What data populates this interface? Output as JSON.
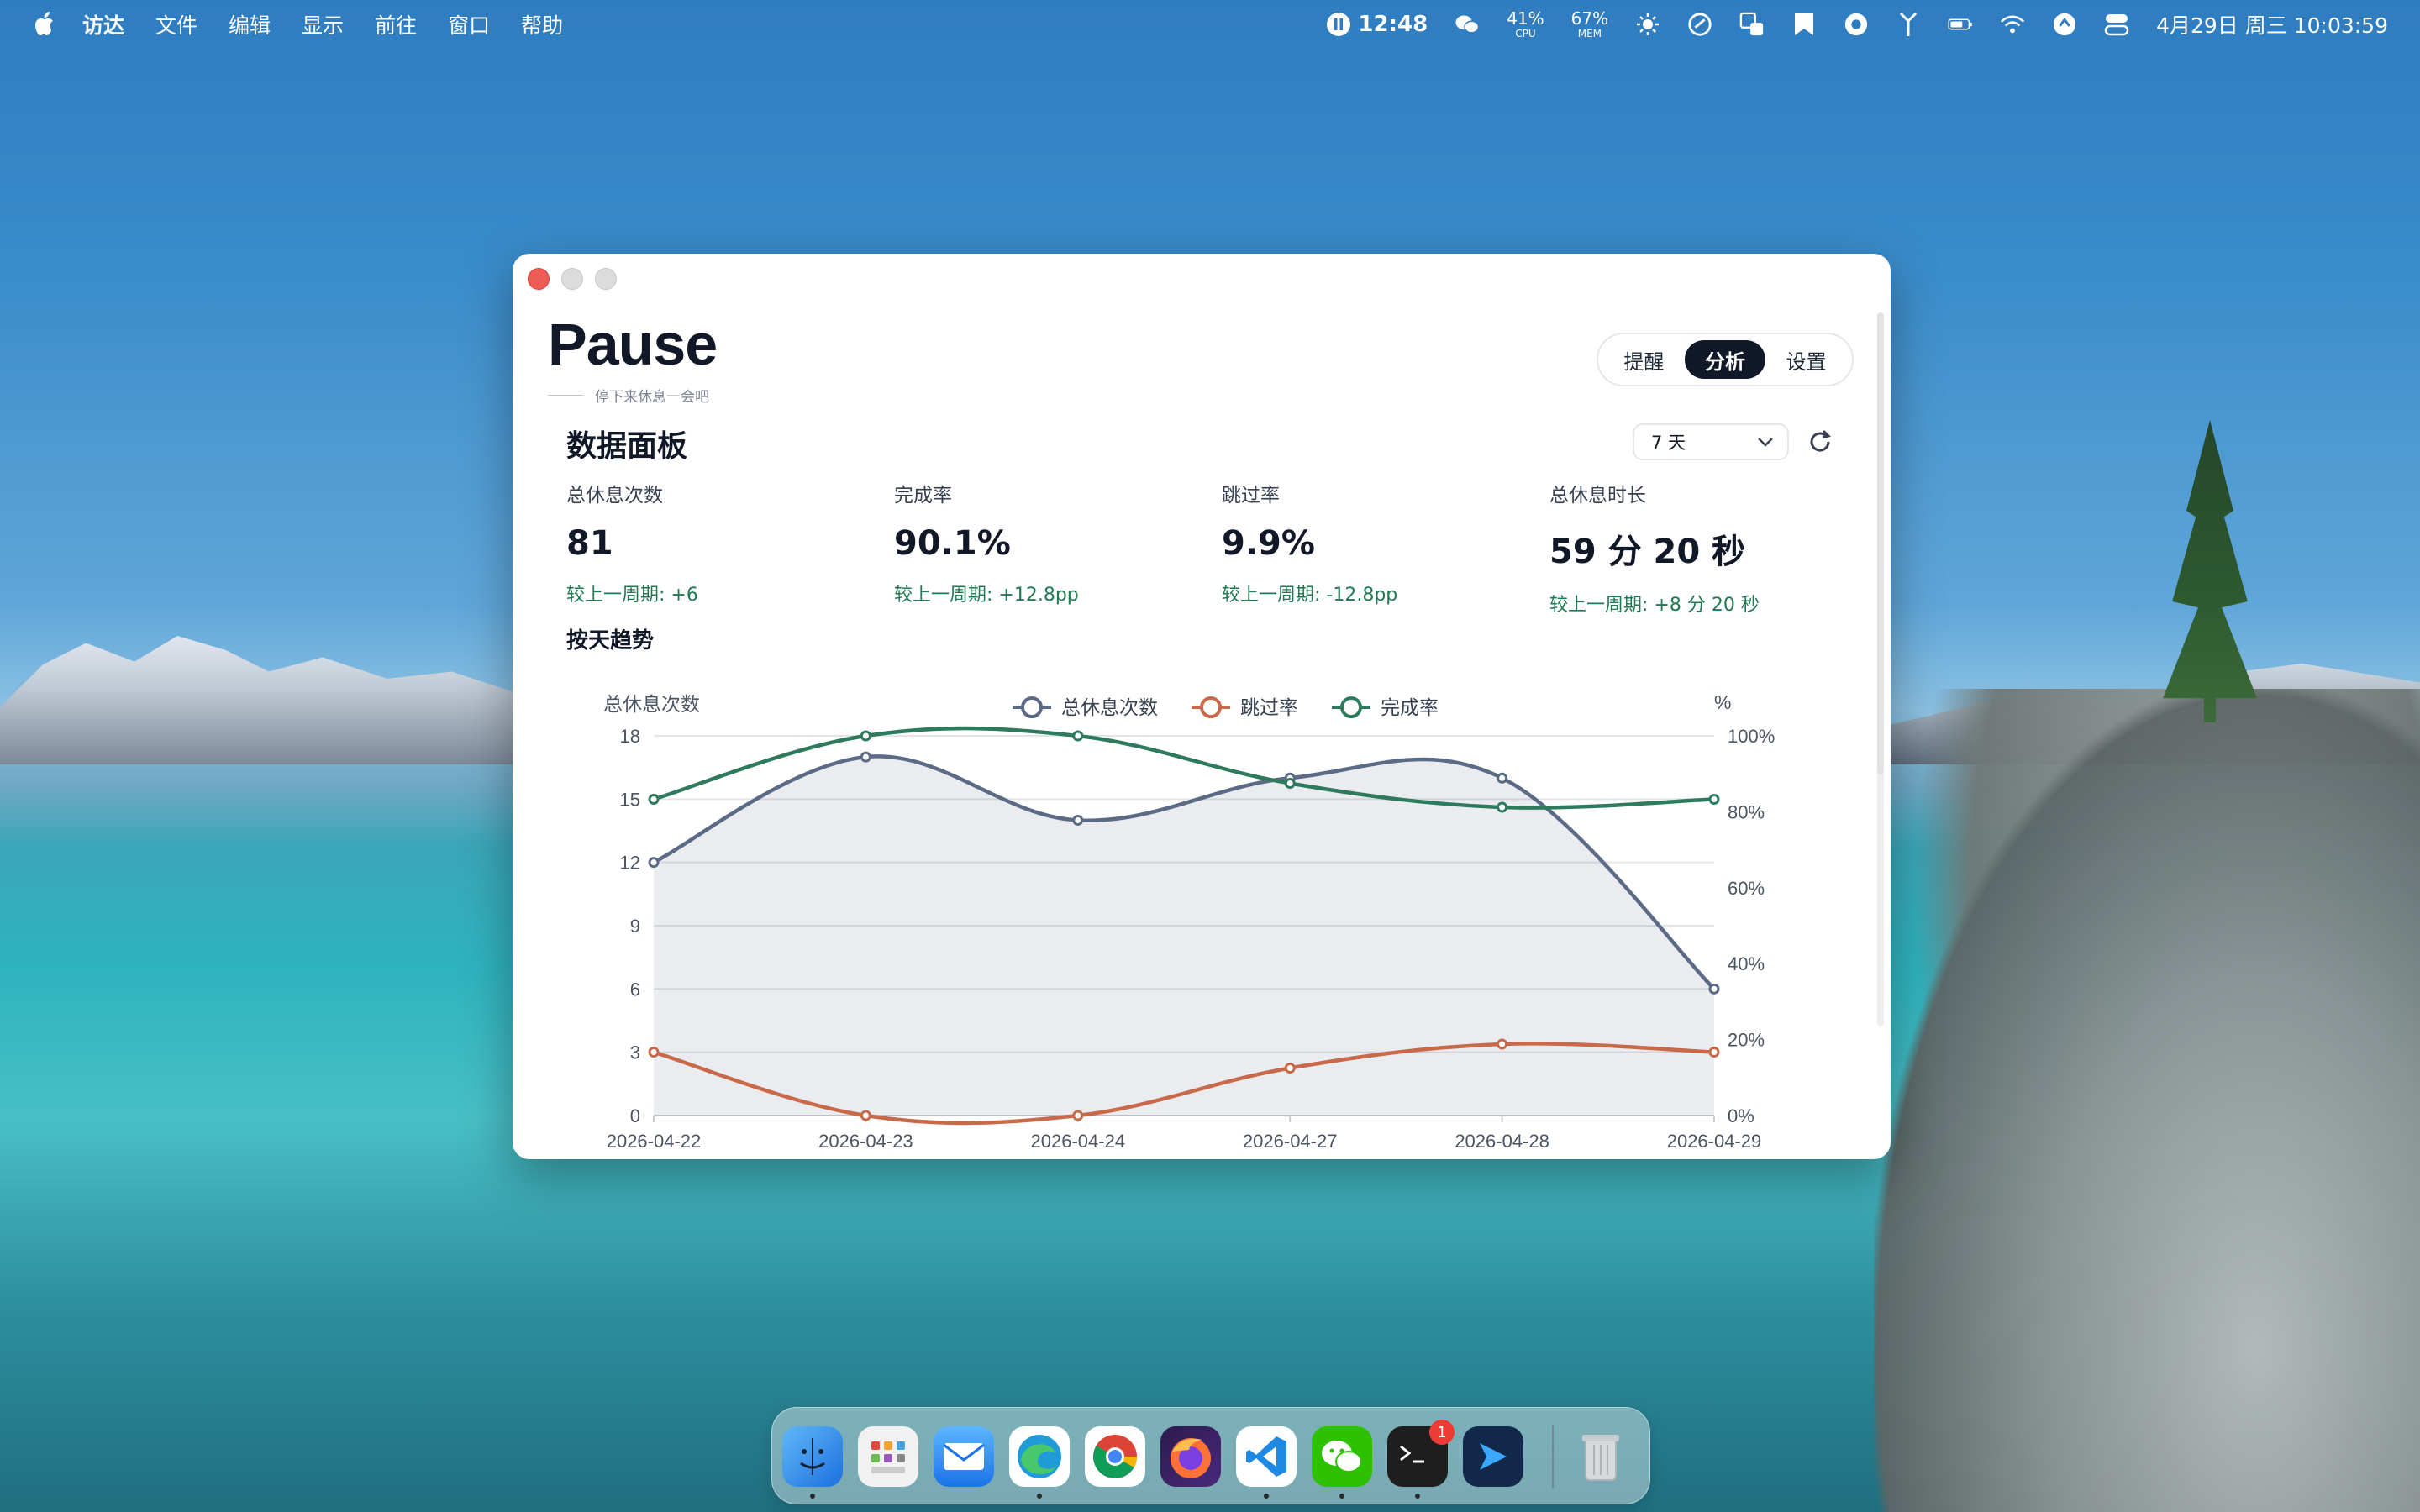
{
  "menubar": {
    "app_name": "访达",
    "items": [
      "文件",
      "编辑",
      "显示",
      "前往",
      "窗口",
      "帮助"
    ],
    "timer": "12:48",
    "cpu_value": "41%",
    "cpu_label": "CPU",
    "mem_value": "67%",
    "mem_label": "MEM",
    "clock": "4月29日 周三  10:03:59",
    "status_icons": [
      "wechat-icon",
      "brightness-icon",
      "app-icon",
      "translate-icon",
      "bookmark-icon",
      "record-icon",
      "fork-icon",
      "battery-icon",
      "wifi-icon",
      "sync-icon",
      "control-center-icon"
    ]
  },
  "window": {
    "brand": "Pause",
    "tagline": "停下来休息一会吧",
    "tabs": [
      {
        "label": "提醒",
        "active": false
      },
      {
        "label": "分析",
        "active": true
      },
      {
        "label": "设置",
        "active": false
      }
    ],
    "panel_title": "数据面板",
    "range_select": "7 天",
    "stats": [
      {
        "label": "总休息次数",
        "value": "81",
        "compare": "较上一周期: +6"
      },
      {
        "label": "完成率",
        "value": "90.1%",
        "compare": "较上一周期: +12.8pp"
      },
      {
        "label": "跳过率",
        "value": "9.9%",
        "compare": "较上一周期: -12.8pp"
      },
      {
        "label": "总休息时长",
        "value": "59 分 20 秒",
        "compare": "较上一周期: +8 分 20 秒"
      }
    ],
    "trend_title": "按天趋势"
  },
  "chart_data": {
    "type": "line",
    "categories": [
      "2026-04-22",
      "2026-04-23",
      "2026-04-24",
      "2026-04-27",
      "2026-04-28",
      "2026-04-29"
    ],
    "ylabel": "总休息次数",
    "ylabel_right": "%",
    "ylim": [
      0,
      18
    ],
    "yticks": [
      0,
      3,
      6,
      9,
      12,
      15,
      18
    ],
    "ylim_right": [
      0,
      100
    ],
    "yticks_right": [
      "0%",
      "20%",
      "40%",
      "60%",
      "80%",
      "100%"
    ],
    "legend_position": "top-center",
    "grid": true,
    "series": [
      {
        "name": "总休息次数",
        "axis": "left",
        "color": "#5b6b86",
        "area": true,
        "values": [
          12,
          17,
          14,
          16,
          16,
          6
        ]
      },
      {
        "name": "跳过率",
        "axis": "right",
        "color": "#c8694a",
        "values": [
          16.7,
          0,
          0,
          12.5,
          18.8,
          16.7
        ]
      },
      {
        "name": "完成率",
        "axis": "right",
        "color": "#2e7a5c",
        "values": [
          83.3,
          100,
          100,
          87.5,
          81.2,
          83.3
        ]
      }
    ]
  },
  "dock": {
    "apps": [
      {
        "name": "finder-icon",
        "running": true
      },
      {
        "name": "launchpad-icon",
        "running": false
      },
      {
        "name": "mail-icon",
        "running": false
      },
      {
        "name": "edge-icon",
        "running": true
      },
      {
        "name": "chrome-icon",
        "running": false
      },
      {
        "name": "firefox-icon",
        "running": false
      },
      {
        "name": "vscode-icon",
        "running": true
      },
      {
        "name": "wechat-icon",
        "running": true
      },
      {
        "name": "terminal-icon",
        "running": true,
        "badge": "1"
      },
      {
        "name": "pause-app-icon",
        "running": false
      }
    ],
    "trash": "trash-icon"
  }
}
